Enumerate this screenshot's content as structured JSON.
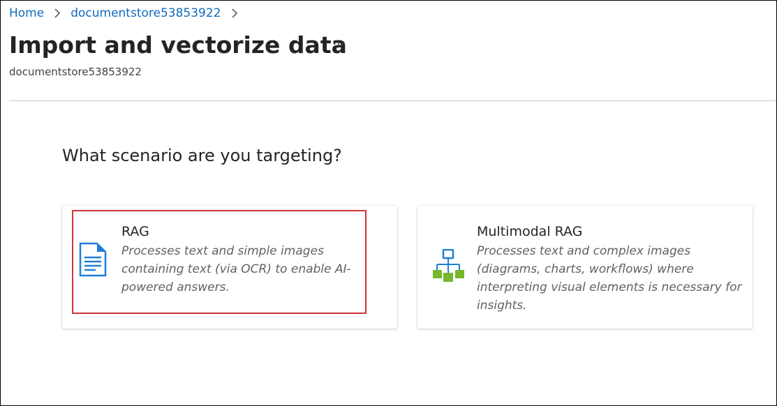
{
  "breadcrumb": {
    "home": "Home",
    "resource": "documentstore53853922"
  },
  "header": {
    "title": "Import and vectorize data",
    "more_label": "···",
    "subtitle": "documentstore53853922"
  },
  "main": {
    "question": "What scenario are you targeting?",
    "cards": [
      {
        "title": "RAG",
        "description": "Processes text and simple images containing text (via OCR) to enable AI-powered answers.",
        "icon": "document-icon",
        "selected": true
      },
      {
        "title": "Multimodal RAG",
        "description": "Processes text and complex images (diagrams, charts, workflows) where interpreting visual elements is necessary for insights.",
        "icon": "hierarchy-diagram-icon",
        "selected": false
      }
    ]
  },
  "colors": {
    "link": "#0f6cbd",
    "highlight": "#d13438",
    "icon_blue": "#1e7fd6",
    "icon_green": "#76b82a"
  }
}
